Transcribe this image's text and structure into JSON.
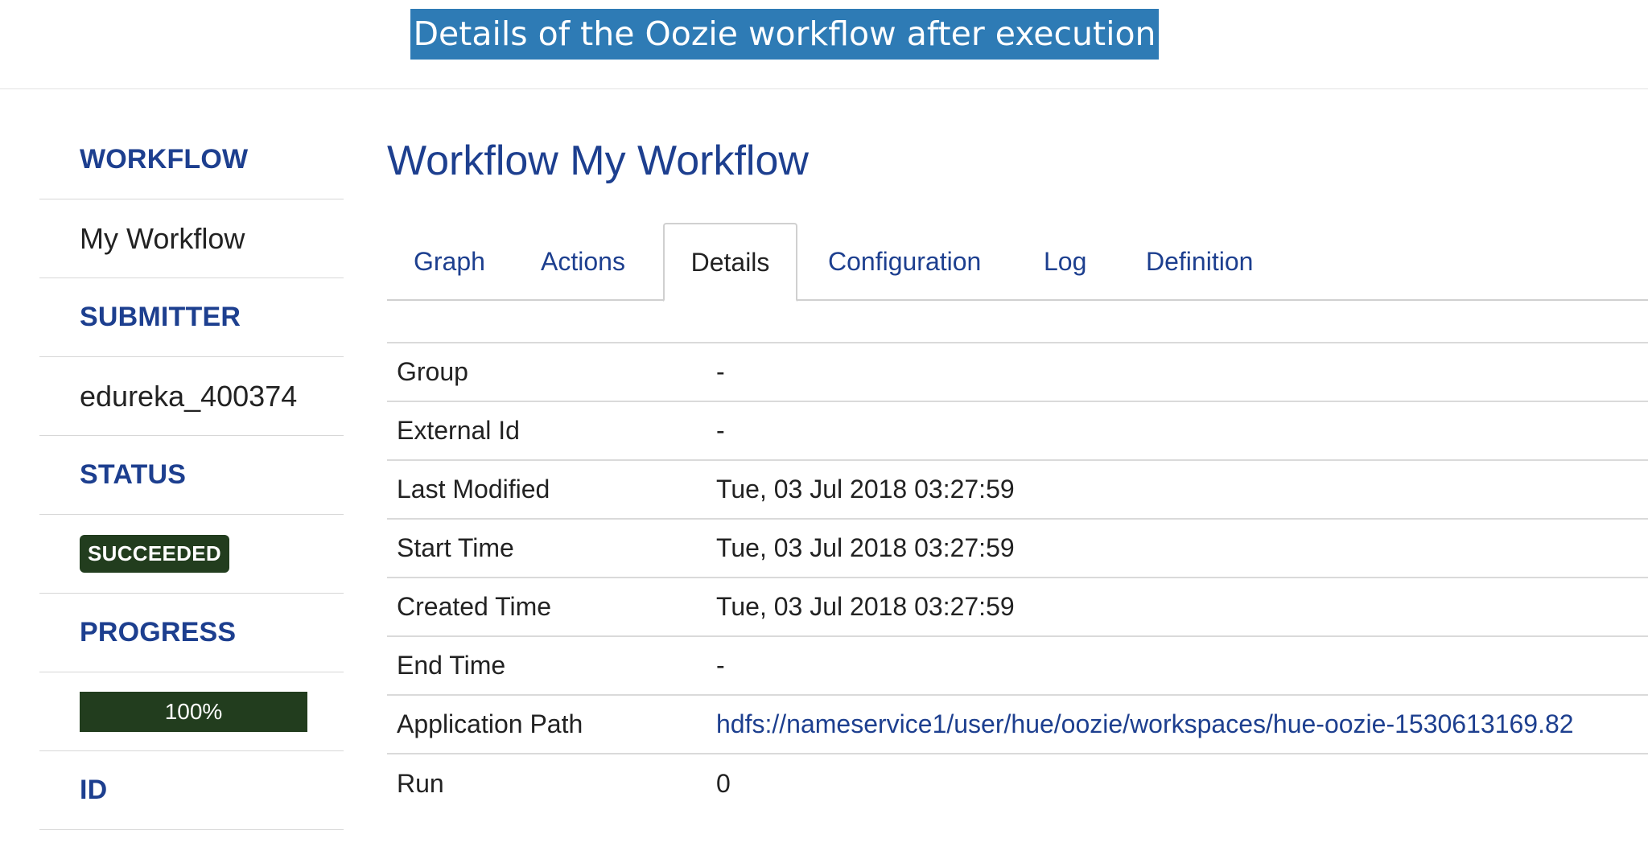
{
  "banner": {
    "title": "Details of the Oozie workflow after execution"
  },
  "sidebar": {
    "workflow_heading": "WORKFLOW",
    "workflow_value": "My Workflow",
    "submitter_heading": "SUBMITTER",
    "submitter_value": "edureka_400374",
    "status_heading": "STATUS",
    "status_value": "SUCCEEDED",
    "progress_heading": "PROGRESS",
    "progress_value": "100%",
    "progress_percent": 100,
    "id_heading": "ID"
  },
  "main": {
    "title": "Workflow My Workflow",
    "tabs": [
      {
        "label": "Graph"
      },
      {
        "label": "Actions"
      },
      {
        "label": "Details"
      },
      {
        "label": "Configuration"
      },
      {
        "label": "Log"
      },
      {
        "label": "Definition"
      }
    ],
    "active_tab": "Details",
    "details": [
      {
        "label": "Group",
        "value": "-"
      },
      {
        "label": "External Id",
        "value": "-"
      },
      {
        "label": "Last Modified",
        "value": "Tue, 03 Jul 2018 03:27:59"
      },
      {
        "label": "Start Time",
        "value": "Tue, 03 Jul 2018 03:27:59"
      },
      {
        "label": "Created Time",
        "value": "Tue, 03 Jul 2018 03:27:59"
      },
      {
        "label": "End Time",
        "value": "-"
      },
      {
        "label": "Application Path",
        "value": "hdfs://nameservice1/user/hue/oozie/workspaces/hue-oozie-1530613169.82"
      },
      {
        "label": "Run",
        "value": "0"
      }
    ]
  },
  "colors": {
    "banner_bg": "#2e7bb5",
    "heading_blue": "#1d3f8f",
    "status_green": "#223d1e"
  }
}
